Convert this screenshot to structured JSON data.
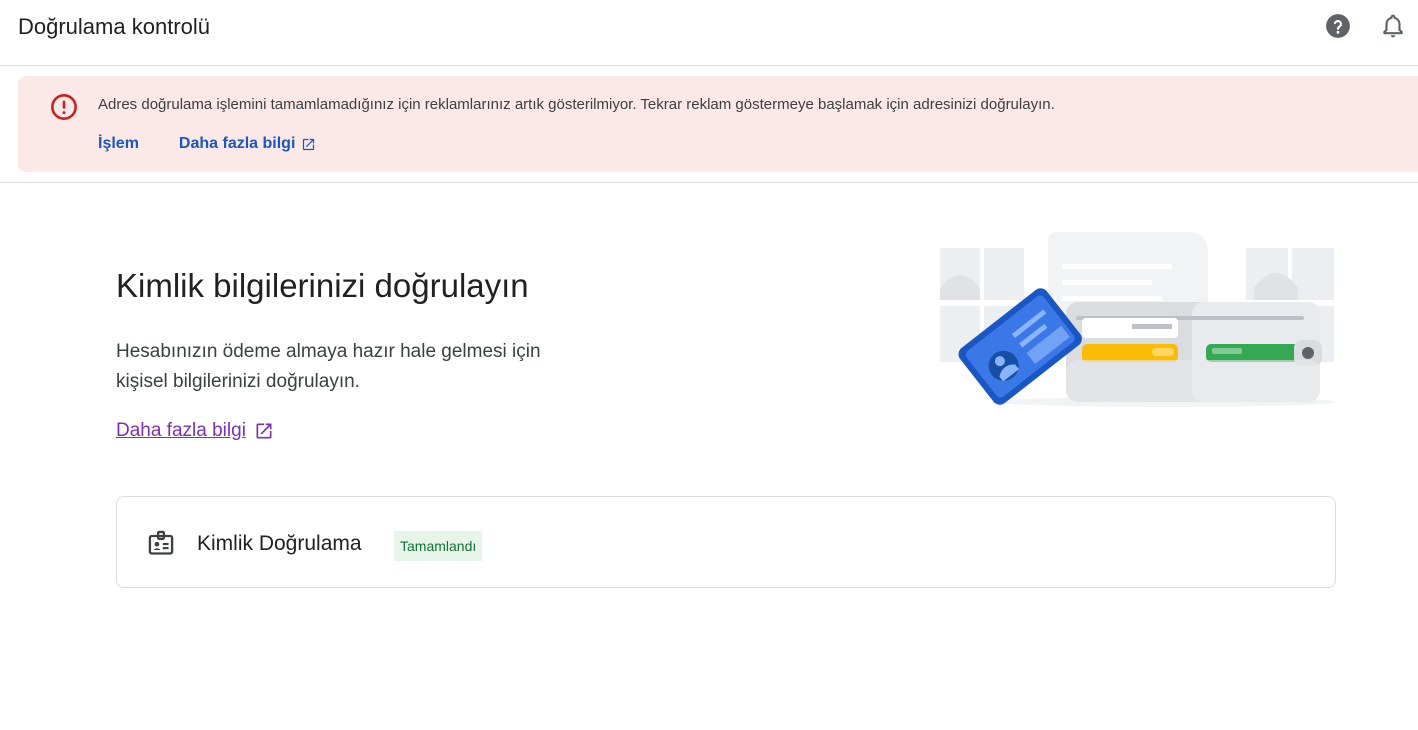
{
  "header": {
    "title": "Doğrulama kontrolü",
    "help_icon": "help-circle-icon",
    "notifications_icon": "bell-icon"
  },
  "alert": {
    "icon": "error-icon",
    "message": "Adres doğrulama işlemini tamamlamadığınız için reklamlarınız artık gösterilmiyor. Tekrar reklam göstermeye başlamak için adresinizi doğrulayın.",
    "action_label": "İşlem",
    "learn_more_label": "Daha fazla bilgi",
    "background_color": "#fce8e6",
    "icon_color": "#c5221f",
    "link_color": "#1a56c4"
  },
  "main": {
    "title": "Kimlik bilgilerinizi doğrulayın",
    "description": "Hesabınızın ödeme almaya hazır hale gelmesi için kişisel bilgilerinizi doğrulayın.",
    "learn_more_label": "Daha fazla bilgi",
    "learn_more_color": "#7b2fb8",
    "illustration": "wallet-id-card-illustration"
  },
  "verification_card": {
    "icon": "id-badge-icon",
    "title": "Kimlik Doğrulama",
    "status": "Tamamlandı",
    "status_bg_color": "#e6f4ea",
    "status_text_color": "#137333"
  }
}
